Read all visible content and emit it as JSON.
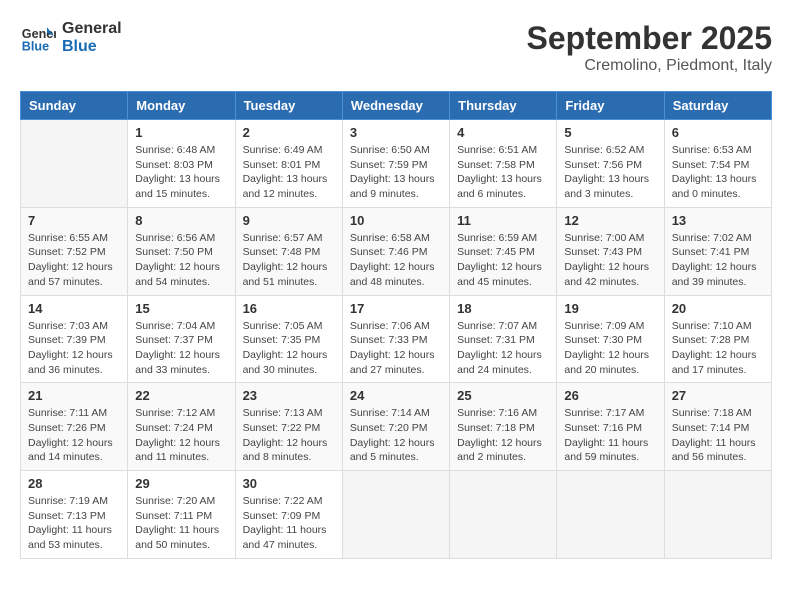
{
  "header": {
    "logo_line1": "General",
    "logo_line2": "Blue",
    "month": "September 2025",
    "location": "Cremolino, Piedmont, Italy"
  },
  "weekdays": [
    "Sunday",
    "Monday",
    "Tuesday",
    "Wednesday",
    "Thursday",
    "Friday",
    "Saturday"
  ],
  "weeks": [
    [
      {
        "day": "",
        "info": ""
      },
      {
        "day": "1",
        "info": "Sunrise: 6:48 AM\nSunset: 8:03 PM\nDaylight: 13 hours\nand 15 minutes."
      },
      {
        "day": "2",
        "info": "Sunrise: 6:49 AM\nSunset: 8:01 PM\nDaylight: 13 hours\nand 12 minutes."
      },
      {
        "day": "3",
        "info": "Sunrise: 6:50 AM\nSunset: 7:59 PM\nDaylight: 13 hours\nand 9 minutes."
      },
      {
        "day": "4",
        "info": "Sunrise: 6:51 AM\nSunset: 7:58 PM\nDaylight: 13 hours\nand 6 minutes."
      },
      {
        "day": "5",
        "info": "Sunrise: 6:52 AM\nSunset: 7:56 PM\nDaylight: 13 hours\nand 3 minutes."
      },
      {
        "day": "6",
        "info": "Sunrise: 6:53 AM\nSunset: 7:54 PM\nDaylight: 13 hours\nand 0 minutes."
      }
    ],
    [
      {
        "day": "7",
        "info": "Sunrise: 6:55 AM\nSunset: 7:52 PM\nDaylight: 12 hours\nand 57 minutes."
      },
      {
        "day": "8",
        "info": "Sunrise: 6:56 AM\nSunset: 7:50 PM\nDaylight: 12 hours\nand 54 minutes."
      },
      {
        "day": "9",
        "info": "Sunrise: 6:57 AM\nSunset: 7:48 PM\nDaylight: 12 hours\nand 51 minutes."
      },
      {
        "day": "10",
        "info": "Sunrise: 6:58 AM\nSunset: 7:46 PM\nDaylight: 12 hours\nand 48 minutes."
      },
      {
        "day": "11",
        "info": "Sunrise: 6:59 AM\nSunset: 7:45 PM\nDaylight: 12 hours\nand 45 minutes."
      },
      {
        "day": "12",
        "info": "Sunrise: 7:00 AM\nSunset: 7:43 PM\nDaylight: 12 hours\nand 42 minutes."
      },
      {
        "day": "13",
        "info": "Sunrise: 7:02 AM\nSunset: 7:41 PM\nDaylight: 12 hours\nand 39 minutes."
      }
    ],
    [
      {
        "day": "14",
        "info": "Sunrise: 7:03 AM\nSunset: 7:39 PM\nDaylight: 12 hours\nand 36 minutes."
      },
      {
        "day": "15",
        "info": "Sunrise: 7:04 AM\nSunset: 7:37 PM\nDaylight: 12 hours\nand 33 minutes."
      },
      {
        "day": "16",
        "info": "Sunrise: 7:05 AM\nSunset: 7:35 PM\nDaylight: 12 hours\nand 30 minutes."
      },
      {
        "day": "17",
        "info": "Sunrise: 7:06 AM\nSunset: 7:33 PM\nDaylight: 12 hours\nand 27 minutes."
      },
      {
        "day": "18",
        "info": "Sunrise: 7:07 AM\nSunset: 7:31 PM\nDaylight: 12 hours\nand 24 minutes."
      },
      {
        "day": "19",
        "info": "Sunrise: 7:09 AM\nSunset: 7:30 PM\nDaylight: 12 hours\nand 20 minutes."
      },
      {
        "day": "20",
        "info": "Sunrise: 7:10 AM\nSunset: 7:28 PM\nDaylight: 12 hours\nand 17 minutes."
      }
    ],
    [
      {
        "day": "21",
        "info": "Sunrise: 7:11 AM\nSunset: 7:26 PM\nDaylight: 12 hours\nand 14 minutes."
      },
      {
        "day": "22",
        "info": "Sunrise: 7:12 AM\nSunset: 7:24 PM\nDaylight: 12 hours\nand 11 minutes."
      },
      {
        "day": "23",
        "info": "Sunrise: 7:13 AM\nSunset: 7:22 PM\nDaylight: 12 hours\nand 8 minutes."
      },
      {
        "day": "24",
        "info": "Sunrise: 7:14 AM\nSunset: 7:20 PM\nDaylight: 12 hours\nand 5 minutes."
      },
      {
        "day": "25",
        "info": "Sunrise: 7:16 AM\nSunset: 7:18 PM\nDaylight: 12 hours\nand 2 minutes."
      },
      {
        "day": "26",
        "info": "Sunrise: 7:17 AM\nSunset: 7:16 PM\nDaylight: 11 hours\nand 59 minutes."
      },
      {
        "day": "27",
        "info": "Sunrise: 7:18 AM\nSunset: 7:14 PM\nDaylight: 11 hours\nand 56 minutes."
      }
    ],
    [
      {
        "day": "28",
        "info": "Sunrise: 7:19 AM\nSunset: 7:13 PM\nDaylight: 11 hours\nand 53 minutes."
      },
      {
        "day": "29",
        "info": "Sunrise: 7:20 AM\nSunset: 7:11 PM\nDaylight: 11 hours\nand 50 minutes."
      },
      {
        "day": "30",
        "info": "Sunrise: 7:22 AM\nSunset: 7:09 PM\nDaylight: 11 hours\nand 47 minutes."
      },
      {
        "day": "",
        "info": ""
      },
      {
        "day": "",
        "info": ""
      },
      {
        "day": "",
        "info": ""
      },
      {
        "day": "",
        "info": ""
      }
    ]
  ]
}
